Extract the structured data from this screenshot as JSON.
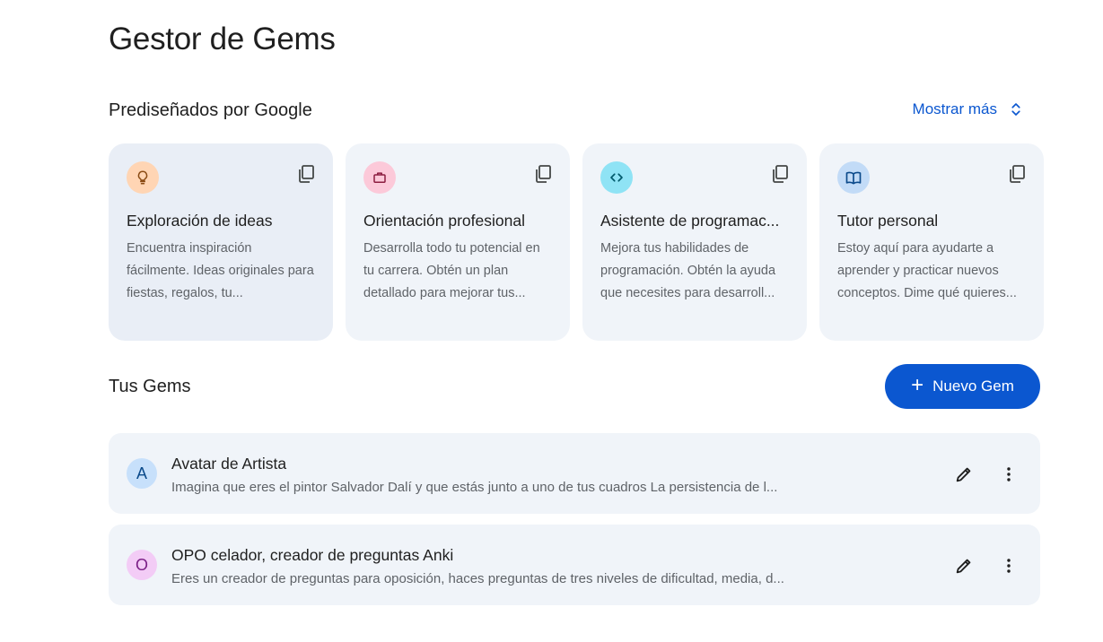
{
  "page_title": "Gestor de Gems",
  "premade": {
    "section_title": "Prediseñados por Google",
    "show_more_label": "Mostrar más",
    "cards": [
      {
        "title": "Exploración de ideas",
        "description": "Encuentra inspiración fácilmente. Ideas originales para fiestas, regalos, tu...",
        "icon": "lightbulb-icon",
        "icon_bg": "#ffd5b4",
        "icon_color": "#8a4b14"
      },
      {
        "title": "Orientación profesional",
        "description": "Desarrolla todo tu potencial en tu carrera. Obtén un plan detallado para mejorar tus...",
        "icon": "briefcase-icon",
        "icon_bg": "#fcc9d9",
        "icon_color": "#8c1d40"
      },
      {
        "title": "Asistente de programac...",
        "description": "Mejora tus habilidades de programación. Obtén la ayuda que necesites para desarroll...",
        "icon": "code-icon",
        "icon_bg": "#8fe3f5",
        "icon_color": "#00596b"
      },
      {
        "title": "Tutor personal",
        "description": "Estoy aquí para ayudarte a aprender y practicar nuevos conceptos. Dime qué quieres...",
        "icon": "book-icon",
        "icon_bg": "#c2dbf7",
        "icon_color": "#0b4a8b"
      }
    ]
  },
  "your_gems": {
    "section_title": "Tus Gems",
    "new_gem_label": "Nuevo Gem",
    "items": [
      {
        "avatar_letter": "A",
        "avatar_bg": "#c7e0fb",
        "avatar_color": "#0b4a8b",
        "name": "Avatar de Artista",
        "description": "Imagina que eres el pintor Salvador Dalí y que estás junto a uno de tus cuadros La persistencia de l..."
      },
      {
        "avatar_letter": "O",
        "avatar_bg": "#f3ccf6",
        "avatar_color": "#7b1f86",
        "name": "OPO celador, creador de preguntas Anki",
        "description": "Eres un creador de preguntas para oposición, haces preguntas de tres niveles de dificultad, media, d..."
      }
    ]
  },
  "colors": {
    "accent": "#0b57d0",
    "card_bg": "#f0f4f9"
  }
}
